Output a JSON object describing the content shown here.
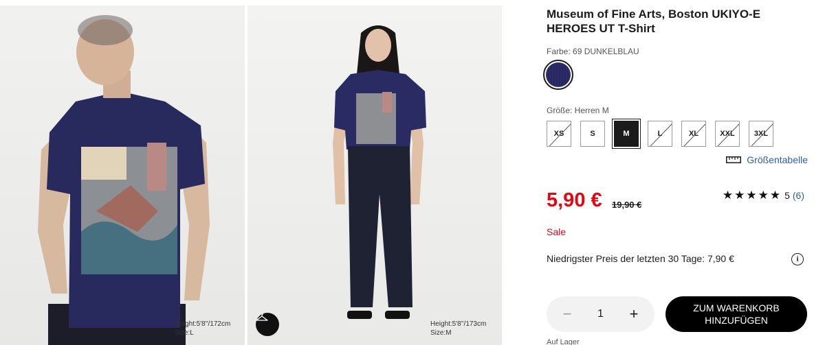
{
  "gallery": {
    "images": [
      {
        "model_info_height": "Height:5'8''/172cm",
        "model_info_size": "Size:L"
      },
      {
        "model_info_height": "Height:5'8''/173cm",
        "model_info_size": "Size:M"
      }
    ],
    "hanger_icon": "hanger-icon"
  },
  "product": {
    "title": "Museum of Fine Arts, Boston UKIYO-E HEROES UT T-Shirt",
    "color_label": "Farbe: 69 DUNKELBLAU",
    "color_hex": "#2b2b66",
    "size_label": "Größe: Herren M",
    "sizes": [
      {
        "label": "XS",
        "available": false
      },
      {
        "label": "S",
        "available": true
      },
      {
        "label": "M",
        "available": true,
        "selected": true
      },
      {
        "label": "L",
        "available": false
      },
      {
        "label": "XL",
        "available": false
      },
      {
        "label": "XXL",
        "available": false
      },
      {
        "label": "3XL",
        "available": false
      }
    ],
    "size_guide_label": "Größentabelle",
    "price": "5,90 €",
    "old_price": "19,90 €",
    "rating_stars": "★★★★★",
    "rating_value": "5",
    "review_count": "(6)",
    "sale_label": "Sale",
    "lowest_price_text": "Niedrigster Preis der letzten 30 Tage: 7,90 €",
    "quantity": "1",
    "add_to_cart": "ZUM WARENKORB HINZUFÜGEN",
    "stock_status": "Auf Lager"
  },
  "colors": {
    "sale_red": "#e30613",
    "link_blue": "#2a5ea8",
    "navy": "#2b2b66"
  }
}
